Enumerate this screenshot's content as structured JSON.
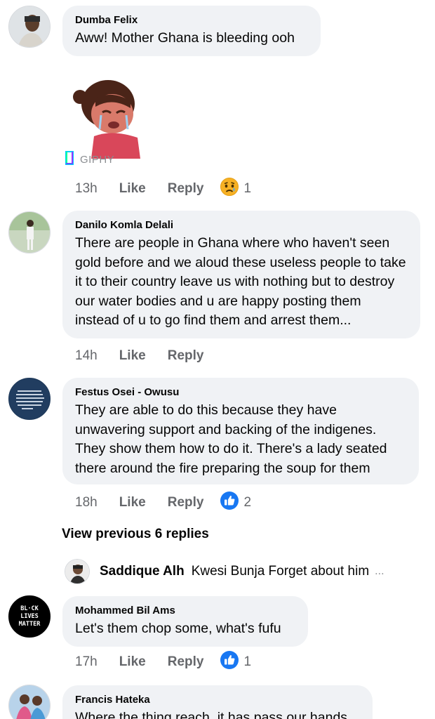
{
  "comments": [
    {
      "author": "Dumba Felix",
      "text": "Aww! Mother Ghana is bleeding ooh",
      "time": "13h",
      "like": "Like",
      "reply": "Reply",
      "reaction_icon": "sad-face-icon",
      "reaction_count": "1",
      "gif_source": "GIPHY"
    },
    {
      "author": "Danilo Komla Delali",
      "text": "There are people in Ghana where who haven't seen gold before and we aloud these useless people to take it to their country leave us with nothing but to destroy our water bodies and u are happy posting them instead of u to go find them and arrest them...",
      "time": "14h",
      "like": "Like",
      "reply": "Reply"
    },
    {
      "author": "Festus Osei - Owusu",
      "text": "They are able to do this because they have unwavering support and backing of the indigenes. They show them how to do it. There's a lady seated there around the fire preparing the soup for them",
      "time": "18h",
      "like": "Like",
      "reply": "Reply",
      "reaction_icon": "thumbs-up-icon",
      "reaction_count": "2"
    },
    {
      "author": "Mohammed Bil Ams",
      "text": "Let's them chop some, what's fufu",
      "time": "17h",
      "like": "Like",
      "reply": "Reply",
      "reaction_icon": "thumbs-up-icon",
      "reaction_count": "1",
      "avatar_text": [
        "BL·CK",
        "LIVES",
        "MATTER"
      ]
    },
    {
      "author": "Francis Hateka",
      "text": "Where the thing reach, it has pass our hands"
    }
  ],
  "view_previous": "View previous 6 replies",
  "collapsed_reply": {
    "author": "Saddique Alh",
    "text": "Kwesi Bunja Forget about him",
    "ellipsis": "..."
  },
  "colors": {
    "bubble": "#f0f2f5",
    "meta": "#65676b",
    "like_blue": "#1877f2",
    "sad_yellow": "#f7b125"
  }
}
